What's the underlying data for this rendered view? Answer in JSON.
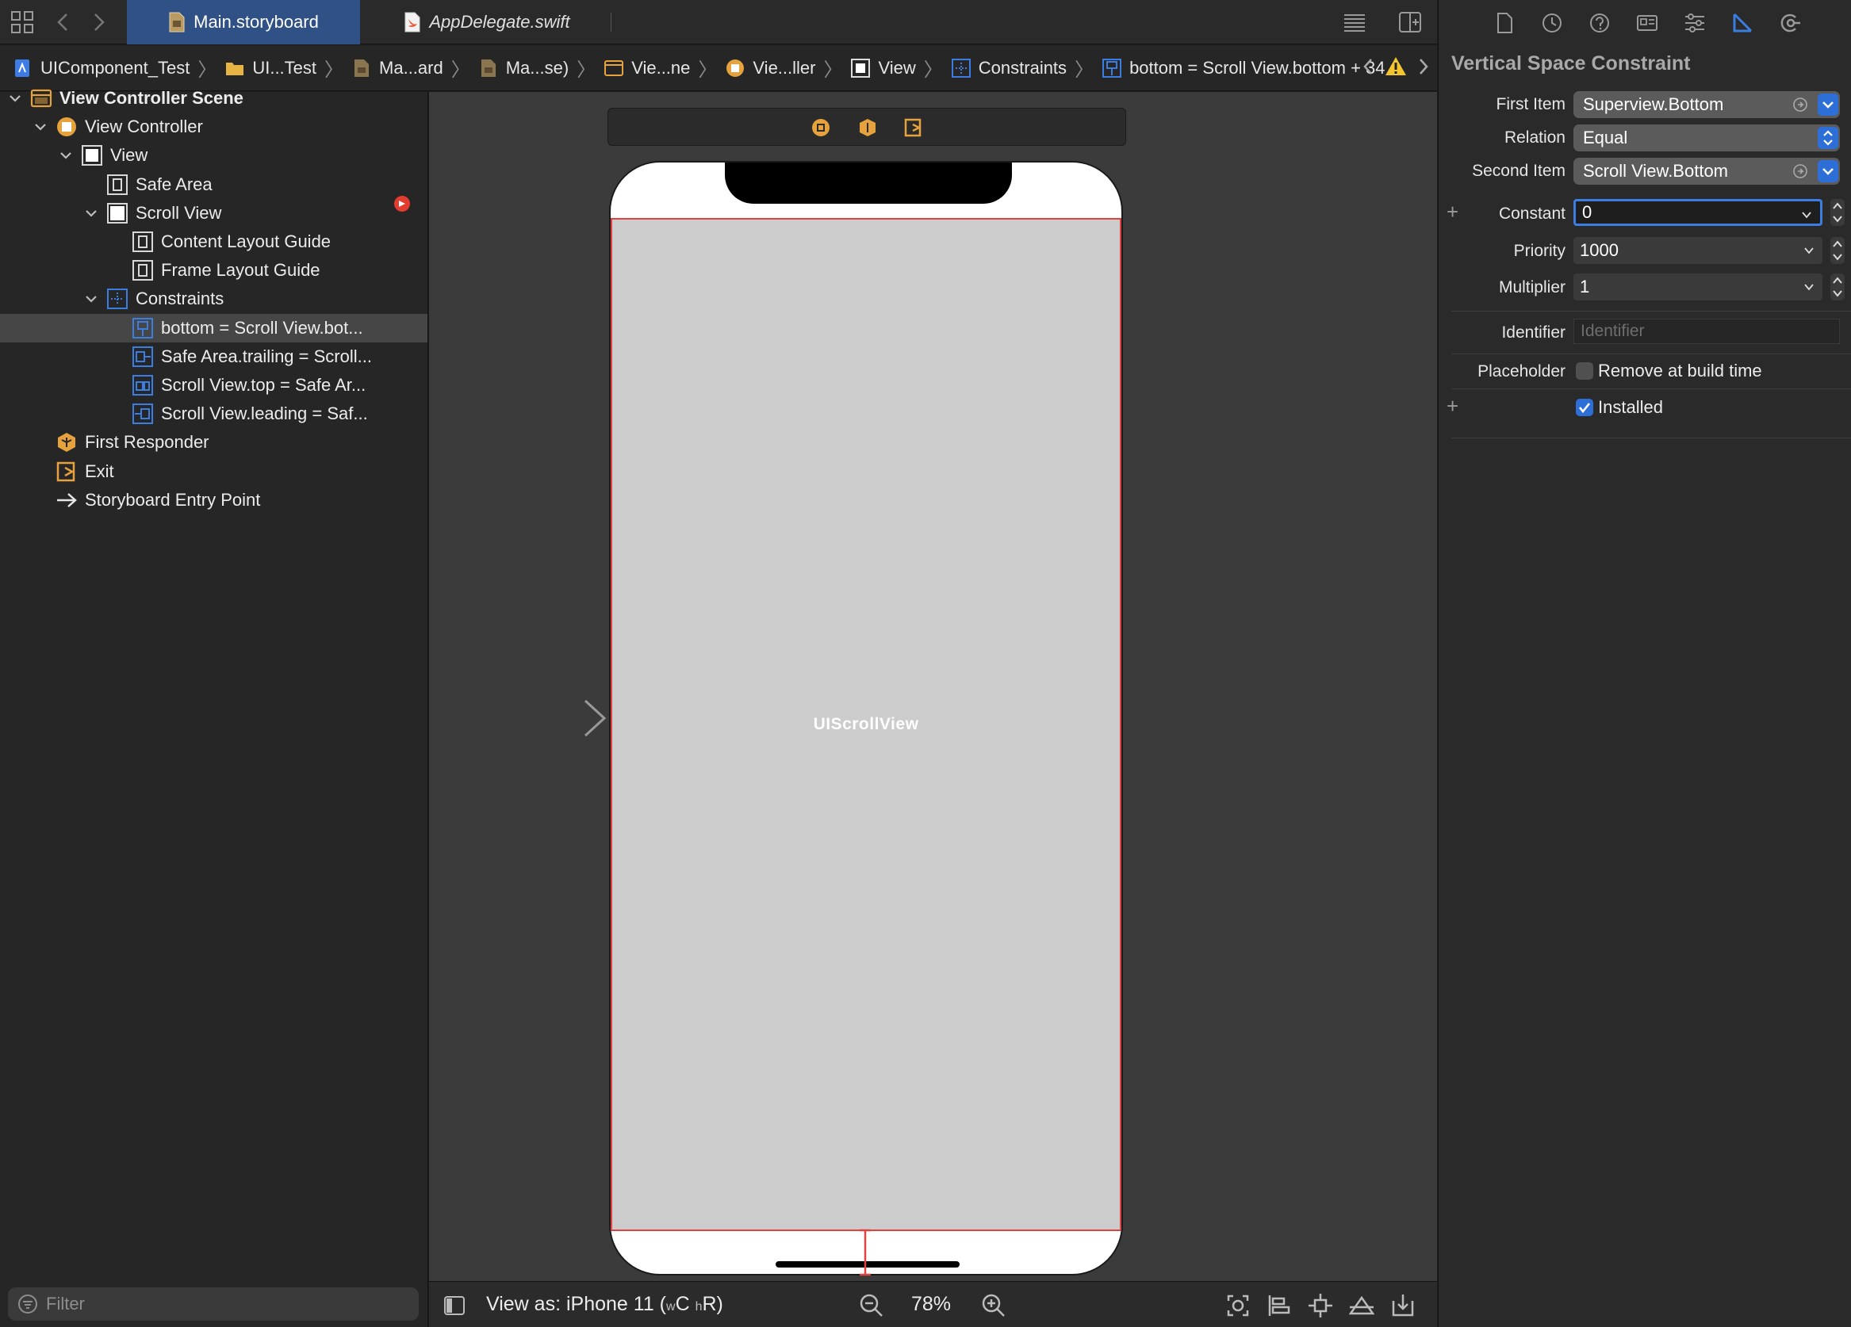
{
  "tabs": [
    {
      "label": "Main.storyboard",
      "active": true
    },
    {
      "label": "AppDelegate.swift",
      "active": false
    }
  ],
  "breadcrumbs": [
    "UIComponent_Test",
    "UI...Test",
    "Ma...ard",
    "Ma...se)",
    "Vie...ne",
    "Vie...ller",
    "View",
    "Constraints",
    "bottom = Scroll View.bottom + 34"
  ],
  "navigator": {
    "items": [
      {
        "label": "View Controller Scene",
        "icon": "scene-icon",
        "depth": 0,
        "disclosure": "open",
        "bold": true
      },
      {
        "label": "View Controller",
        "icon": "view-controller-icon",
        "depth": 1,
        "disclosure": "open"
      },
      {
        "label": "View",
        "icon": "view-icon",
        "depth": 2,
        "disclosure": "open"
      },
      {
        "label": "Safe Area",
        "icon": "layout-guide-icon",
        "depth": 3,
        "disclosure": "none"
      },
      {
        "label": "Scroll View",
        "icon": "scroll-view-icon",
        "depth": 3,
        "disclosure": "open"
      },
      {
        "label": "Content Layout Guide",
        "icon": "layout-guide-icon",
        "depth": 4,
        "disclosure": "none"
      },
      {
        "label": "Frame Layout Guide",
        "icon": "layout-guide-icon",
        "depth": 4,
        "disclosure": "none"
      },
      {
        "label": "Constraints",
        "icon": "constraints-icon",
        "depth": 3,
        "disclosure": "open"
      },
      {
        "label": "bottom = Scroll View.bot...",
        "icon": "constraint-vertical-icon",
        "depth": 4,
        "disclosure": "none",
        "selected": true
      },
      {
        "label": "Safe Area.trailing = Scroll...",
        "icon": "constraint-trailing-icon",
        "depth": 4,
        "disclosure": "none"
      },
      {
        "label": "Scroll View.top = Safe Ar...",
        "icon": "constraint-top-icon",
        "depth": 4,
        "disclosure": "none"
      },
      {
        "label": "Scroll View.leading = Saf...",
        "icon": "constraint-leading-icon",
        "depth": 4,
        "disclosure": "none"
      },
      {
        "label": "First Responder",
        "icon": "first-responder-icon",
        "depth": 1,
        "disclosure": "none"
      },
      {
        "label": "Exit",
        "icon": "exit-icon",
        "depth": 1,
        "disclosure": "none"
      },
      {
        "label": "Storyboard Entry Point",
        "icon": "entry-arrow-icon",
        "depth": 1,
        "disclosure": "none"
      }
    ],
    "filter_placeholder": "Filter"
  },
  "canvas": {
    "scroll_view_label": "UIScrollView",
    "view_as_prefix": "View as: iPhone 11 (",
    "view_as_w": "w",
    "view_as_c": "C ",
    "view_as_h": "h",
    "view_as_r": "R)",
    "zoom": "78%"
  },
  "inspector": {
    "title": "Vertical Space Constraint",
    "first_item_label": "First Item",
    "first_item_value": "Superview.Bottom",
    "relation_label": "Relation",
    "relation_value": "Equal",
    "second_item_label": "Second Item",
    "second_item_value": "Scroll View.Bottom",
    "constant_label": "Constant",
    "constant_value": "0",
    "priority_label": "Priority",
    "priority_value": "1000",
    "multiplier_label": "Multiplier",
    "multiplier_value": "1",
    "identifier_label": "Identifier",
    "identifier_placeholder": "Identifier",
    "placeholder_label": "Placeholder",
    "remove_at_build_label": "Remove at build time",
    "installed_label": "Installed",
    "installed_checked": true,
    "remove_checked": false
  },
  "colors": {
    "accent": "#2d6fd6",
    "selected_tab": "#2f5185",
    "constraint_red": "#e04141",
    "object_orange": "#e6a23c"
  }
}
